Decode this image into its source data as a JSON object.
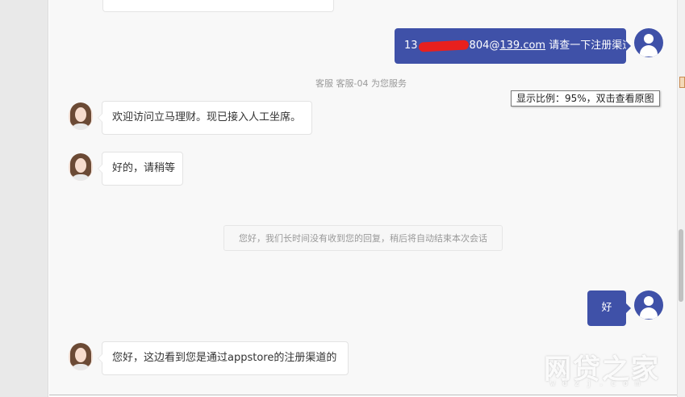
{
  "conversation": {
    "user_msg_1": {
      "email_prefix": "13",
      "email_suffix": "804@",
      "email_domain": "139.com",
      "text": " 请查一下注册渠道"
    },
    "system_assign": "客服 客服-04 为您服务",
    "agent_msg_1": "欢迎访问立马理财。现已接入人工坐席。",
    "agent_msg_2": "好的，请稍等",
    "idle_notice": "您好，我们长时间没有收到您的回复，稍后将自动结束本次会话",
    "user_msg_2": "好",
    "agent_msg_3": "您好，这边看到您是通过appstore的注册渠道的"
  },
  "tooltip": "显示比例：95%，双击查看原图",
  "watermark": {
    "main": "网贷之家",
    "sub": "wdzj.com"
  },
  "colors": {
    "user_bubble": "#3f51a8",
    "agent_bubble": "#ffffff",
    "redaction": "#e8201e"
  },
  "icons": {
    "user_avatar": "user-silhouette-icon",
    "agent_avatar": "agent-photo-avatar"
  }
}
